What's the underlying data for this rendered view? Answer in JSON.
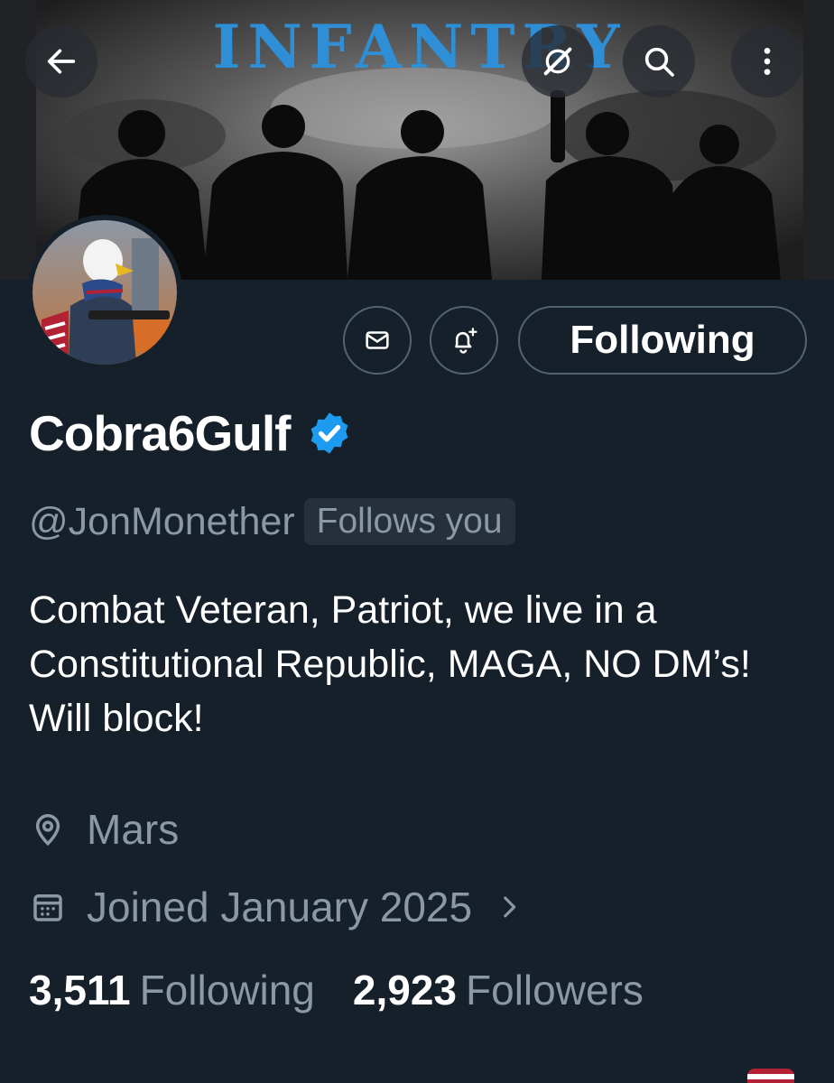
{
  "banner": {
    "title": "INFANTRY"
  },
  "header": {
    "back_icon": "arrow-left-icon",
    "grok_icon": "grok-icon",
    "search_icon": "search-icon",
    "more_icon": "more-vertical-icon"
  },
  "actions": {
    "message_icon": "envelope-icon",
    "notify_icon": "bell-plus-icon",
    "following_label": "Following"
  },
  "profile": {
    "display_name": "Cobra6Gulf",
    "verified": true,
    "handle": "@JonMonether",
    "follows_you": "Follows you",
    "bio": "Combat Veteran, Patriot, we live in a Constitutional Republic, MAGA, NO DM’s! Will block!",
    "location": "Mars",
    "joined": "Joined January 2025"
  },
  "stats": {
    "following_count": "3,511",
    "following_label": "Following",
    "followers_count": "2,923",
    "followers_label": "Followers"
  },
  "colors": {
    "background": "#15202b",
    "muted_text": "#8b98a5",
    "verified_blue": "#1d9bf0",
    "banner_title": "#2e8fd6"
  }
}
